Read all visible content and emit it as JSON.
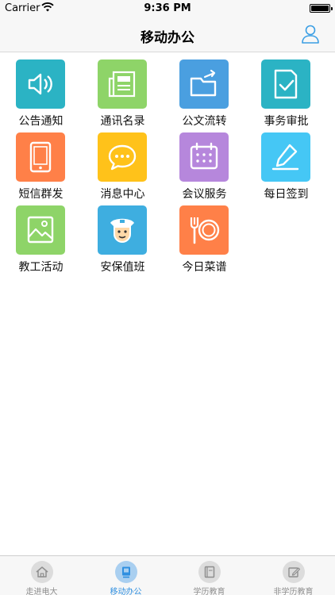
{
  "status_bar": {
    "carrier": "Carrier",
    "time": "9:36 PM",
    "battery_level": 1.0
  },
  "nav": {
    "title": "移动办公",
    "user_icon": "user-icon"
  },
  "tiles": [
    {
      "label": "公告通知",
      "icon": "speaker-icon",
      "color": "#2bb3c4"
    },
    {
      "label": "通讯名录",
      "icon": "newspaper-icon",
      "color": "#8ed468"
    },
    {
      "label": "公文流转",
      "icon": "folder-share-icon",
      "color": "#4a9fe0"
    },
    {
      "label": "事务审批",
      "icon": "document-check-icon",
      "color": "#2bb3c4"
    },
    {
      "label": "短信群发",
      "icon": "tablet-icon",
      "color": "#ff8048"
    },
    {
      "label": "消息中心",
      "icon": "chat-bubble-icon",
      "color": "#ffc21a"
    },
    {
      "label": "会议服务",
      "icon": "calendar-icon",
      "color": "#b687dc"
    },
    {
      "label": "每日签到",
      "icon": "pencil-icon",
      "color": "#45c7f5"
    },
    {
      "label": "教工活动",
      "icon": "picture-icon",
      "color": "#8ed468"
    },
    {
      "label": "安保值班",
      "icon": "guard-icon",
      "color": "#3eaee0"
    },
    {
      "label": "今日菜谱",
      "icon": "plate-fork-icon",
      "color": "#ff8048"
    }
  ],
  "tab_bar": {
    "tabs": [
      {
        "label": "走进电大",
        "icon": "home-icon",
        "active": false
      },
      {
        "label": "移动办公",
        "icon": "office-icon",
        "active": true
      },
      {
        "label": "学历教育",
        "icon": "book-icon",
        "active": false
      },
      {
        "label": "非学历教育",
        "icon": "edit-icon",
        "active": false
      }
    ],
    "active_color": "#2f8fe0",
    "inactive_color": "#8e8e8e"
  }
}
